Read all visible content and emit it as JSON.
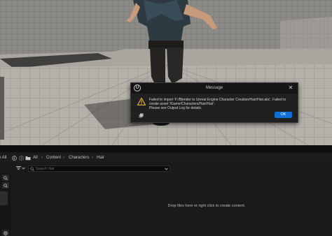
{
  "dialog": {
    "title": "Message",
    "logo_text": "U",
    "close_label": "✕",
    "message_lines": [
      "Failed to import 'F:/Blender to Unreal Engine Character Creation/Hair/Hair.abc'. Failed to",
      "create asset '/Game/Characters/Hair/Hair'.",
      "Please see Output Log for details."
    ],
    "ok_label": "OK",
    "icons": {
      "logo": "unreal-logo-icon",
      "warning": "warning-icon",
      "copy": "copy-icon",
      "close": "close-icon"
    }
  },
  "content_browser": {
    "left_fragment": "e All",
    "path": [
      "All",
      "Content",
      "Characters",
      "Hair"
    ],
    "search_placeholder": "Search Hair",
    "empty_message": "Drop files here or right click to create content.",
    "icons": [
      "history-back-icon",
      "history-forward-icon",
      "folder-icon",
      "filter-icon",
      "search-icon",
      "settings-icon"
    ]
  },
  "colors": {
    "ok_button": "#0f6fd6",
    "dialog_bg": "#202020",
    "panel_bg": "#1a1a1a"
  }
}
